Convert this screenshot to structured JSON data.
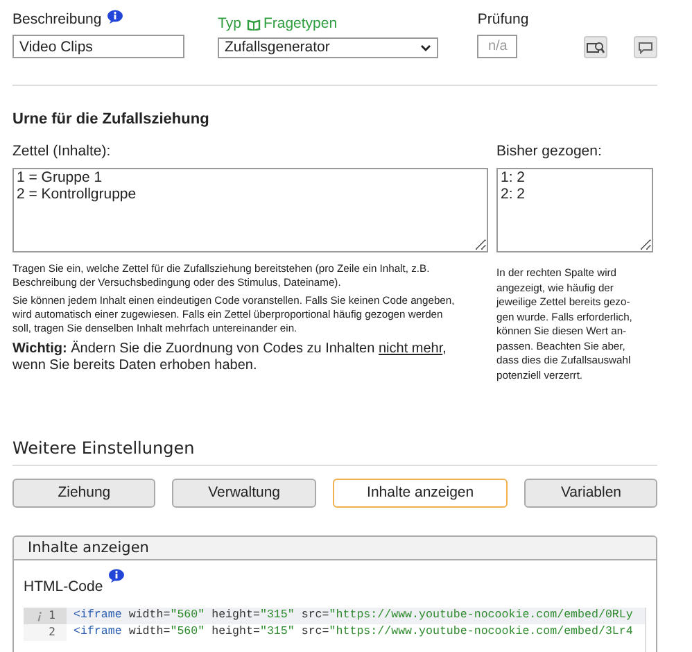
{
  "fields": {
    "description": {
      "label": "Beschreibung",
      "value": "Video Clips"
    },
    "type": {
      "label": "Typ",
      "link": "Fragetypen",
      "value": "Zufallsgenerator"
    },
    "check": {
      "label": "Prüfung",
      "placeholder": "n/a"
    }
  },
  "urn": {
    "title": "Urne für die Zufallsziehung",
    "contents_label": "Zettel (Inhalte):",
    "contents": "1 = Gruppe 1\n2 = Kontrollgruppe",
    "drawn_label": "Bisher gezogen:",
    "drawn": "1: 2\n2: 2",
    "help": [
      "Tragen Sie ein, welche Zettel für die Zufallsziehung bereitstehen (pro Zeile ein Inhalt, z.B. Beschreibung der Versuchsbedingung oder des Stimulus, Dateiname).",
      "Sie können jedem Inhalt einen eindeutigen Code voranstellen. Falls Sie keinen Code angeben, wird automatisch einer zugewiesen. Falls ein Zettel überproportional häufig gezogen werden soll, tragen Sie denselben Inhalt mehrfach untereinander ein."
    ],
    "warning": {
      "text": "**Wichtig:** Ändern Sie die Zuordnung von Codes zu Inhalten",
      "underlined": "nicht mehr",
      "rest": ", wenn Sie bereits Daten erhoben haben."
    },
    "side_help": "In der rechten Spalte wird angezeigt, wie häufig der jeweilige Zettel bereits gezo- gen wurde. Falls erforderlich, können Sie diesen Wert an- passen. Beachten Sie aber, dass dies die Zufallsauswahl potenziell verzerrt."
  },
  "settings": {
    "title": "Weitere Einstellungen",
    "tabs": [
      {
        "label": "Ziehung",
        "selected": false
      },
      {
        "label": "Verwaltung",
        "selected": false
      },
      {
        "label": "Inhalte anzeigen",
        "selected": true
      },
      {
        "label": "Variablen",
        "selected": false
      }
    ]
  },
  "panel": {
    "title": "Inhalte anzeigen",
    "code_label": "HTML-Code",
    "lines": [
      {
        "number": "1",
        "active": true,
        "tokens": [
          {
            "kind": "tag",
            "text": "<iframe"
          },
          {
            "kind": "attr",
            "text": " width="
          },
          {
            "kind": "string",
            "text": "\"560\""
          },
          {
            "kind": "attr",
            "text": " height="
          },
          {
            "kind": "string",
            "text": "\"315\""
          },
          {
            "kind": "attr",
            "text": " src="
          },
          {
            "kind": "string",
            "text": "\"https://www.youtube-nocookie.com/embed/0RLy"
          }
        ]
      },
      {
        "number": "2",
        "active": false,
        "tokens": [
          {
            "kind": "tag",
            "text": "<iframe"
          },
          {
            "kind": "attr",
            "text": " width="
          },
          {
            "kind": "string",
            "text": "\"560\""
          },
          {
            "kind": "attr",
            "text": " height="
          },
          {
            "kind": "string",
            "text": "\"315\""
          },
          {
            "kind": "attr",
            "text": " src="
          },
          {
            "kind": "string",
            "text": "\"https://www.youtube-nocookie.com/embed/3Lr4"
          }
        ]
      }
    ]
  }
}
